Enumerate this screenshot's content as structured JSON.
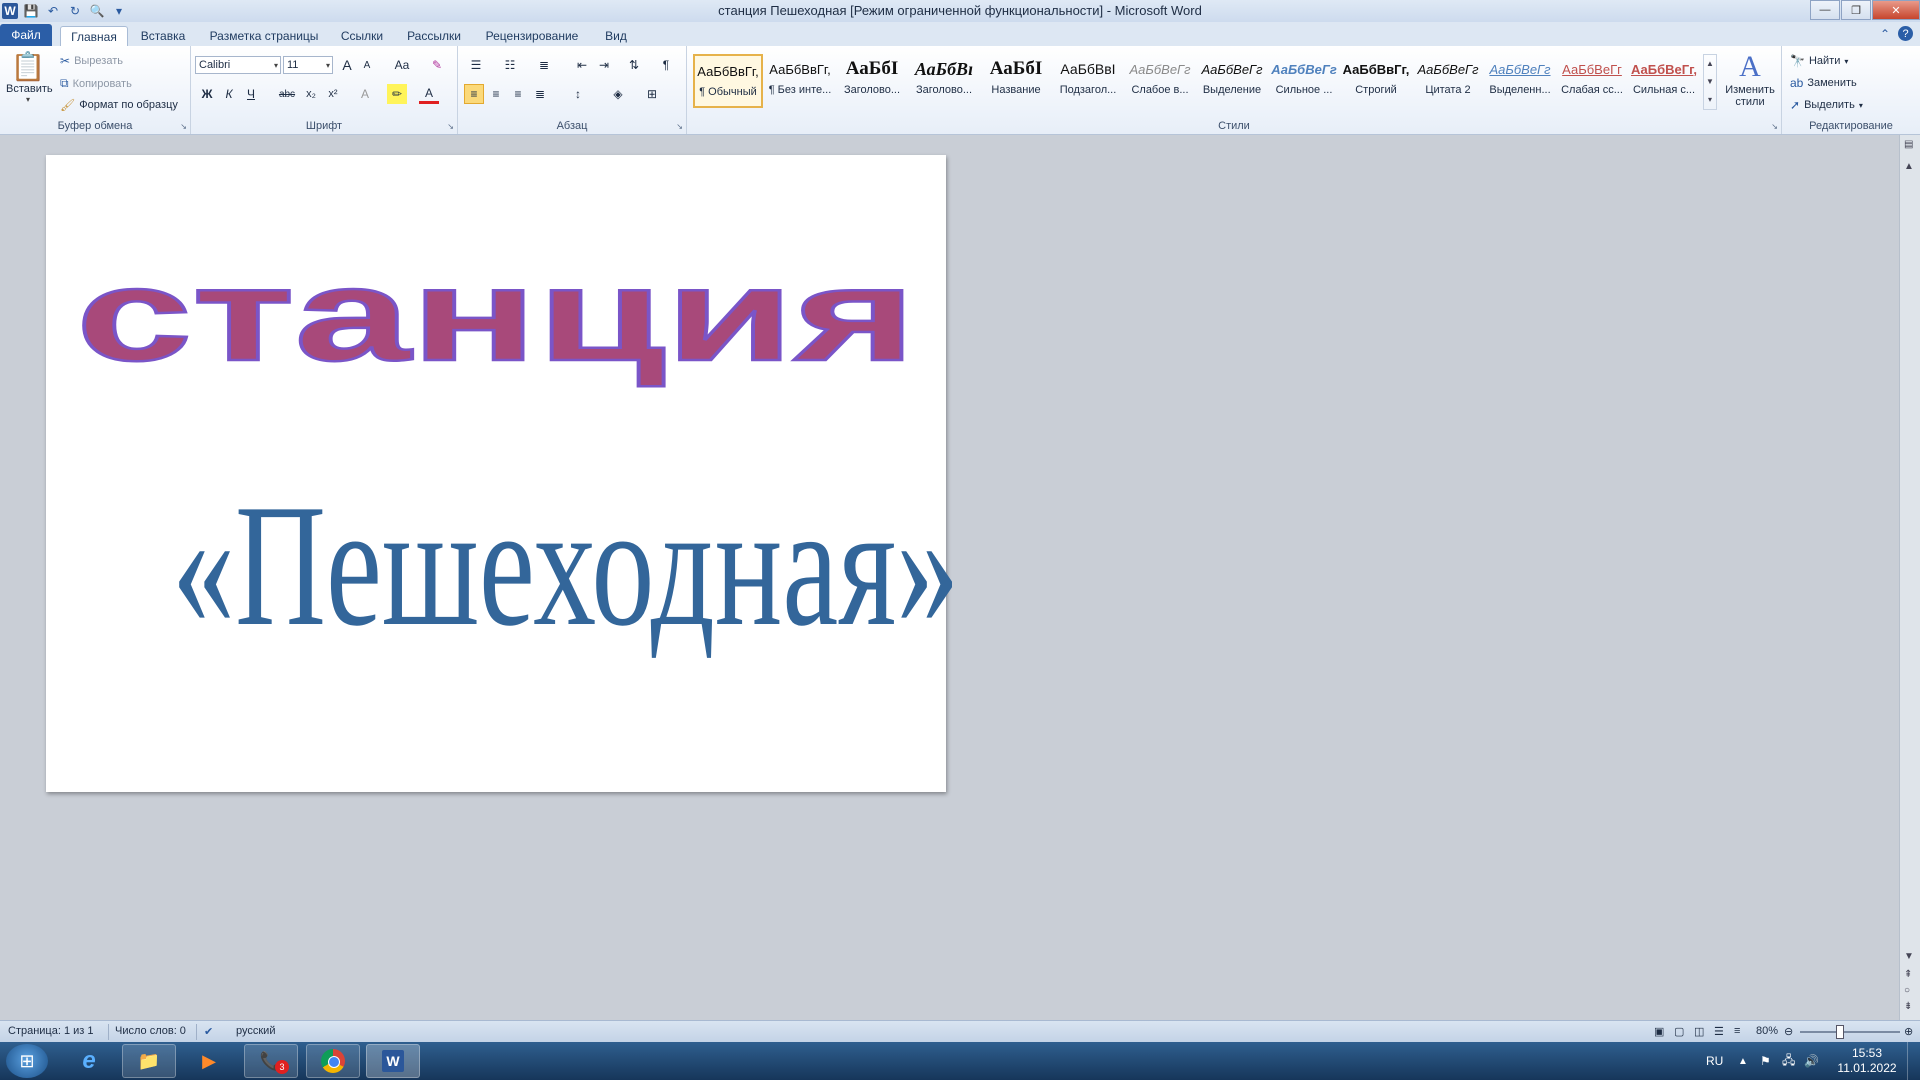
{
  "window": {
    "title": "станция Пешеходная [Режим ограниченной функциональности] - Microsoft Word"
  },
  "tabs": [
    {
      "label": "Файл",
      "left": 0
    },
    {
      "label": "Главная"
    },
    {
      "label": "Вставка"
    },
    {
      "label": "Разметка страницы"
    },
    {
      "label": "Ссылки"
    },
    {
      "label": "Рассылки"
    },
    {
      "label": "Рецензирование"
    },
    {
      "label": "Вид"
    }
  ],
  "clipboard": {
    "paste": "Вставить",
    "cut": "Вырезать",
    "copy": "Копировать",
    "format_painter": "Формат по образцу",
    "group": "Буфер обмена"
  },
  "font": {
    "name": "Calibri",
    "size": "11",
    "group": "Шрифт",
    "bold": "Ж",
    "italic": "К",
    "underline": "Ч",
    "strike": "abc",
    "sub": "x₂",
    "sup": "x²",
    "grow": "A",
    "shrink": "A",
    "case": "Aa"
  },
  "paragraph": {
    "group": "Абзац",
    "pilcrow": "¶"
  },
  "styles": {
    "group": "Стили",
    "items": [
      {
        "preview": "АаБбВвГг,",
        "name": "¶ Обычный"
      },
      {
        "preview": "АаБбВвГг,",
        "name": "¶ Без инте..."
      },
      {
        "preview": "АаБбI",
        "name": "Заголово..."
      },
      {
        "preview": "АаБбВı",
        "name": "Заголово..."
      },
      {
        "preview": "АаБбI",
        "name": "Название"
      },
      {
        "preview": "АаБбВвI",
        "name": "Подзагол..."
      },
      {
        "preview": "АаБбВеГг",
        "name": "Слабое в..."
      },
      {
        "preview": "АаБбВеГг",
        "name": "Выделение"
      },
      {
        "preview": "АаБбВеГг",
        "name": "Сильное ..."
      },
      {
        "preview": "АаБбВвГг,",
        "name": "Строгий"
      },
      {
        "preview": "АаБбВеГг",
        "name": "Цитата 2"
      },
      {
        "preview": "АаБбВеГг",
        "name": "Выделенн..."
      },
      {
        "preview": "АаБбВеГг",
        "name": "Слабая сс..."
      },
      {
        "preview": "АаБбВеГг,",
        "name": "Сильная с..."
      }
    ],
    "change_styles": "Изменить стили"
  },
  "editing": {
    "group": "Редактирование",
    "find": "Найти",
    "replace": "Заменить",
    "select": "Выделить"
  },
  "document": {
    "line1": "станция",
    "line2": "«Пешеходная»",
    "colors": {
      "line1_fill": "#a8497a",
      "line1_outline": "#7a55c8",
      "line2": "#33669a"
    }
  },
  "status": {
    "page": "Страница: 1 из 1",
    "words": "Число слов: 0",
    "language": "русский",
    "zoom": "80%"
  },
  "taskbar": {
    "lang": "RU",
    "time": "15:53",
    "date": "11.01.2022",
    "viber_badge": "3"
  }
}
